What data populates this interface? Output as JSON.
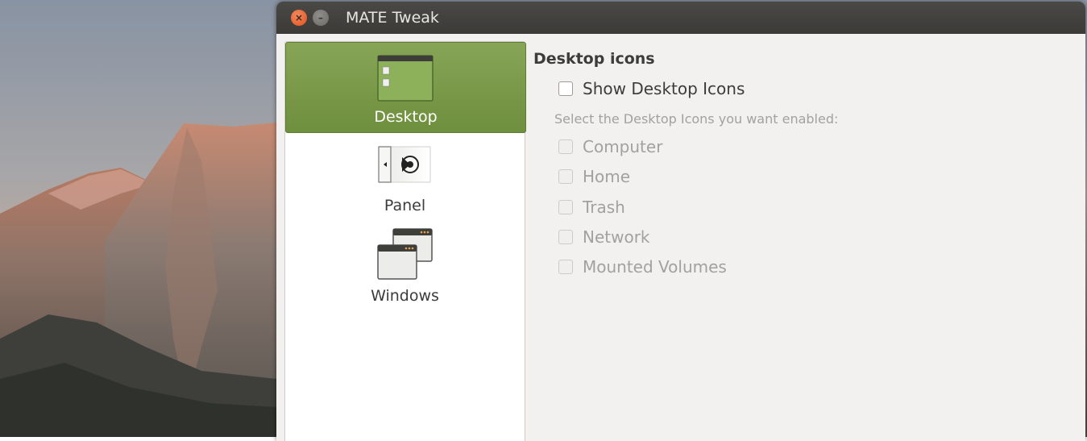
{
  "window": {
    "title": "MATE Tweak",
    "close_glyph": "×",
    "minimize_glyph": "–"
  },
  "sidebar": {
    "items": [
      {
        "label": "Desktop",
        "icon": "desktop-icon",
        "active": true
      },
      {
        "label": "Panel",
        "icon": "panel-icon",
        "active": false
      },
      {
        "label": "Windows",
        "icon": "windows-icon",
        "active": false
      }
    ]
  },
  "main": {
    "section_title": "Desktop icons",
    "show_desktop_icons": {
      "label": "Show Desktop Icons",
      "checked": false
    },
    "hint": "Select the Desktop Icons you want enabled:",
    "options": [
      {
        "label": "Computer",
        "checked": false,
        "enabled": false
      },
      {
        "label": "Home",
        "checked": false,
        "enabled": false
      },
      {
        "label": "Trash",
        "checked": false,
        "enabled": false
      },
      {
        "label": "Network",
        "checked": false,
        "enabled": false
      },
      {
        "label": "Mounted Volumes",
        "checked": false,
        "enabled": false
      }
    ]
  },
  "colors": {
    "accent": "#77984a",
    "titlebar": "#3f3e3b",
    "window_bg": "#f2f1f0",
    "close_button": "#e9592a"
  }
}
